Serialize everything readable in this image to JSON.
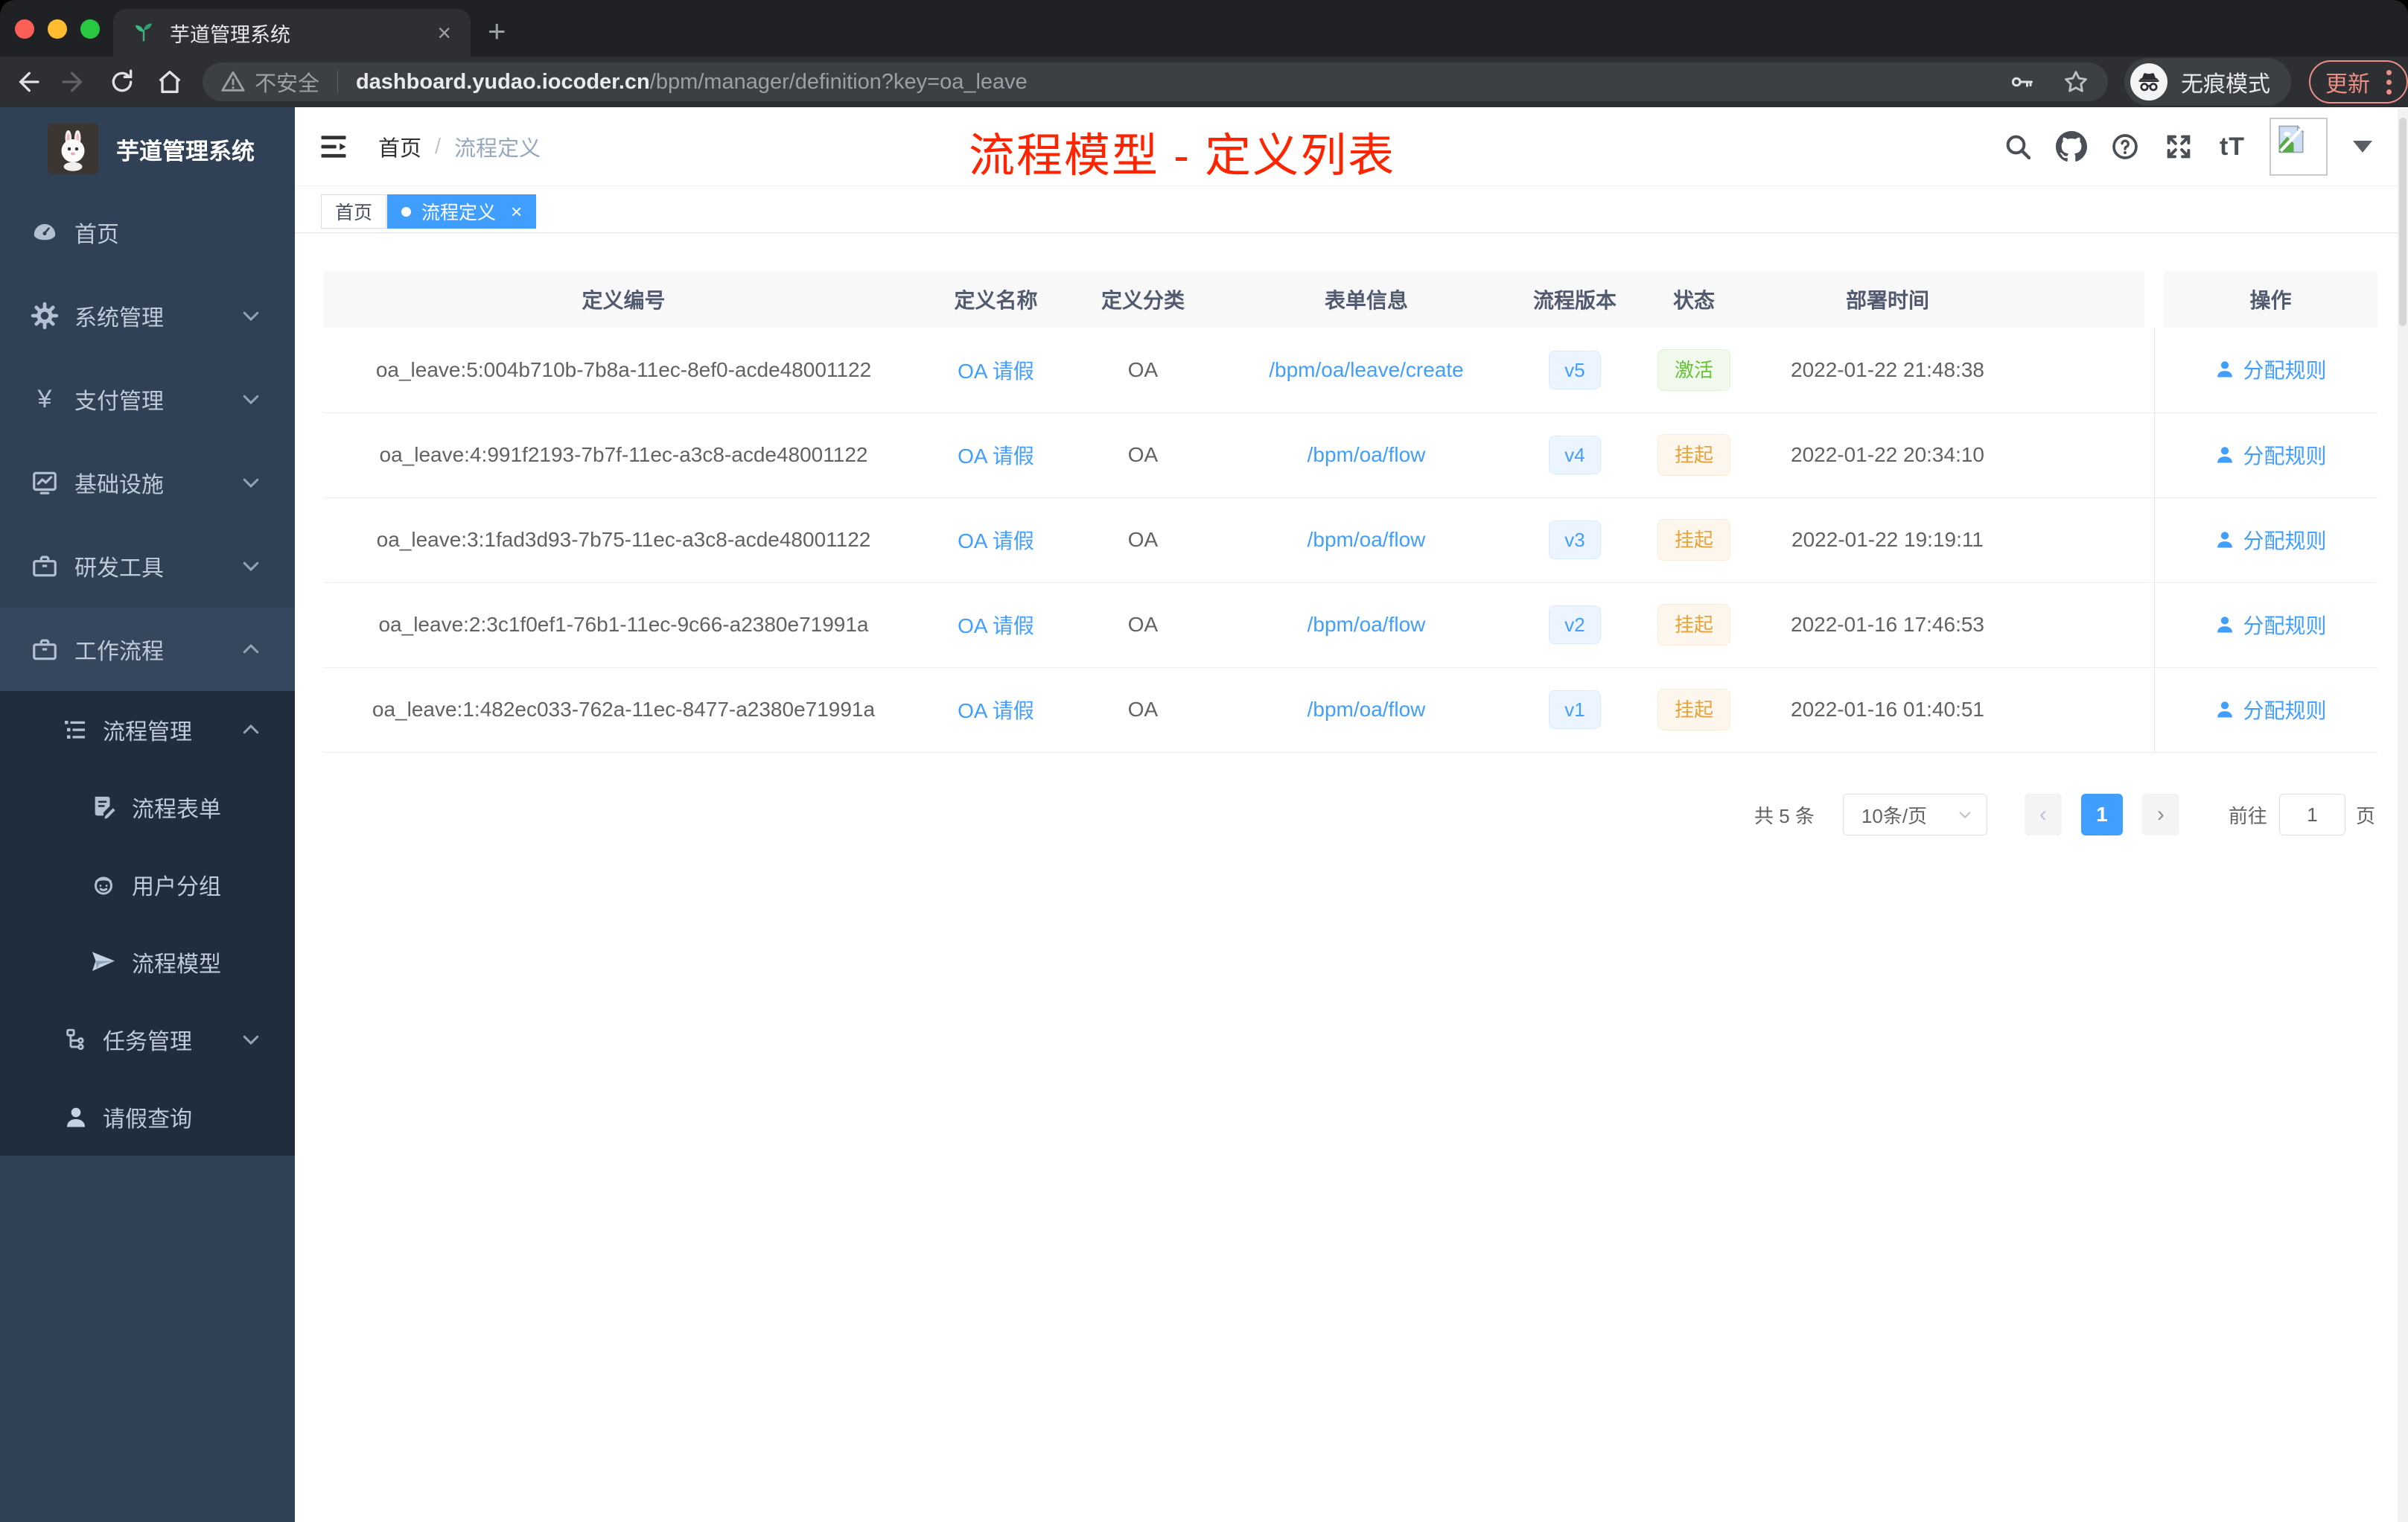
{
  "browser": {
    "tab": {
      "title": "芋道管理系统",
      "close": "×",
      "new_tab": "+"
    },
    "address": {
      "security_label": "不安全",
      "host": "dashboard.yudao.iocoder.cn",
      "path": "/bpm/manager/definition?key=oa_leave"
    },
    "incognito_label": "无痕模式",
    "update_label": "更新"
  },
  "sidebar": {
    "title": "芋道管理系统",
    "items": [
      {
        "label": "首页"
      },
      {
        "label": "系统管理"
      },
      {
        "label": "支付管理"
      },
      {
        "label": "基础设施"
      },
      {
        "label": "研发工具"
      },
      {
        "label": "工作流程"
      },
      {
        "label": "流程管理"
      },
      {
        "label": "流程表单"
      },
      {
        "label": "用户分组"
      },
      {
        "label": "流程模型"
      },
      {
        "label": "任务管理"
      },
      {
        "label": "请假查询"
      }
    ]
  },
  "header": {
    "breadcrumb": [
      "首页",
      "流程定义"
    ],
    "separator": "/",
    "annotation": "流程模型 - 定义列表",
    "font_size_icon": "tT"
  },
  "tags": {
    "home": "首页",
    "active": "流程定义",
    "close": "×"
  },
  "table": {
    "columns": [
      "定义编号",
      "定义名称",
      "定义分类",
      "表单信息",
      "流程版本",
      "状态",
      "部署时间",
      "操作"
    ],
    "action_label": "分配规则",
    "rows": [
      {
        "id": "oa_leave:5:004b710b-7b8a-11ec-8ef0-acde48001122",
        "name": "OA 请假",
        "category": "OA",
        "form": "/bpm/oa/leave/create",
        "version": "v5",
        "status": "激活",
        "status_type": "success",
        "time": "2022-01-22 21:48:38"
      },
      {
        "id": "oa_leave:4:991f2193-7b7f-11ec-a3c8-acde48001122",
        "name": "OA 请假",
        "category": "OA",
        "form": "/bpm/oa/flow",
        "version": "v4",
        "status": "挂起",
        "status_type": "warning",
        "time": "2022-01-22 20:34:10"
      },
      {
        "id": "oa_leave:3:1fad3d93-7b75-11ec-a3c8-acde48001122",
        "name": "OA 请假",
        "category": "OA",
        "form": "/bpm/oa/flow",
        "version": "v3",
        "status": "挂起",
        "status_type": "warning",
        "time": "2022-01-22 19:19:11"
      },
      {
        "id": "oa_leave:2:3c1f0ef1-76b1-11ec-9c66-a2380e71991a",
        "name": "OA 请假",
        "category": "OA",
        "form": "/bpm/oa/flow",
        "version": "v2",
        "status": "挂起",
        "status_type": "warning",
        "time": "2022-01-16 17:46:53"
      },
      {
        "id": "oa_leave:1:482ec033-762a-11ec-8477-a2380e71991a",
        "name": "OA 请假",
        "category": "OA",
        "form": "/bpm/oa/flow",
        "version": "v1",
        "status": "挂起",
        "status_type": "warning",
        "time": "2022-01-16 01:40:51"
      }
    ]
  },
  "pagination": {
    "total": "共 5 条",
    "page_size": "10条/页",
    "prev": "‹",
    "current": "1",
    "next": "›",
    "goto_label": "前往",
    "goto_value": "1",
    "page_label": "页"
  },
  "colors": {
    "accent": "#409eff",
    "annotation_red": "#ff2400",
    "success": "#67c23a",
    "warning": "#e6a23c",
    "sidebar_bg": "#304156",
    "submenu_bg": "#1f2d3d"
  }
}
